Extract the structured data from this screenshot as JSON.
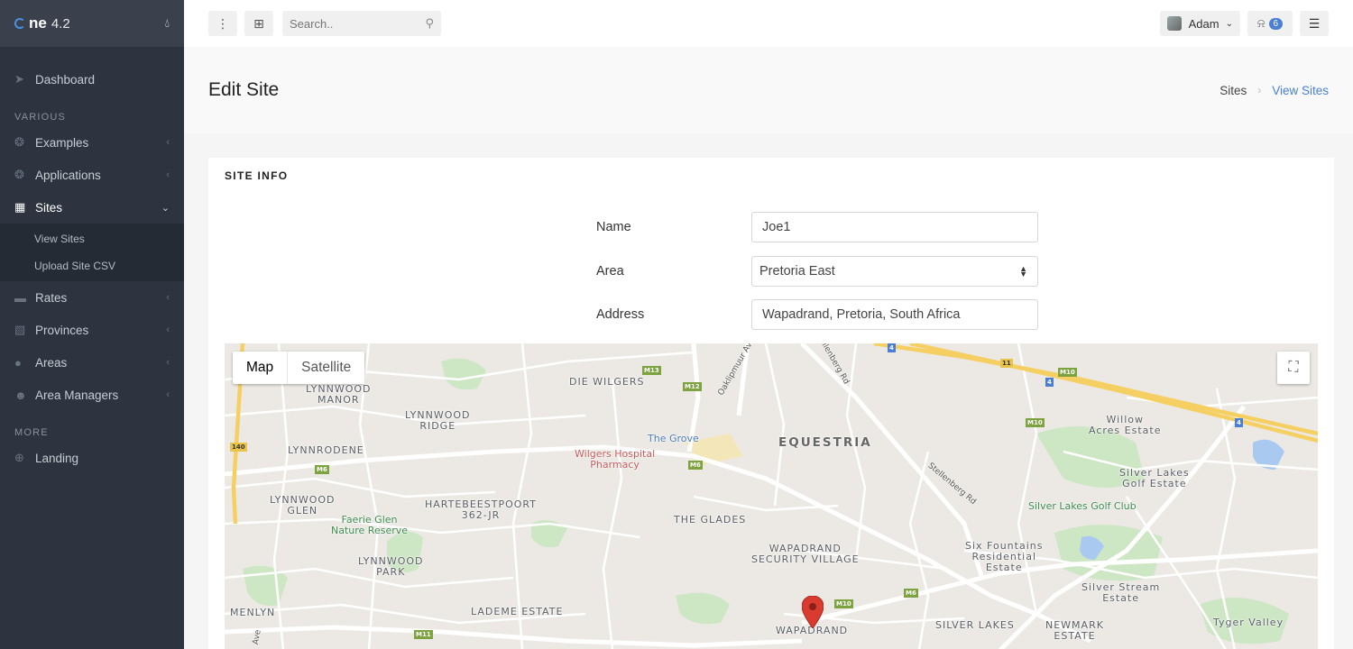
{
  "brand": {
    "logo": "ne",
    "version": "4.2"
  },
  "sidebar": {
    "items": [
      {
        "label": "Dashboard",
        "icon": "paper-plane-icon"
      }
    ],
    "various_heading": "VARIOUS",
    "various": [
      {
        "label": "Examples",
        "icon": "bulb-icon"
      },
      {
        "label": "Applications",
        "icon": "bulb-icon"
      },
      {
        "label": "Sites",
        "icon": "building-icon",
        "active": true
      }
    ],
    "sites_sub": [
      {
        "label": "View Sites"
      },
      {
        "label": "Upload Site CSV"
      }
    ],
    "various2": [
      {
        "label": "Rates",
        "icon": "money-icon"
      },
      {
        "label": "Provinces",
        "icon": "cubes-icon"
      },
      {
        "label": "Areas",
        "icon": "map-marker-icon"
      },
      {
        "label": "Area Managers",
        "icon": "users-icon"
      }
    ],
    "more_heading": "MORE",
    "more": [
      {
        "label": "Landing",
        "icon": "globe-icon"
      }
    ]
  },
  "topbar": {
    "search_placeholder": "Search..",
    "user_name": "Adam",
    "notification_count": "6"
  },
  "header": {
    "title": "Edit Site",
    "breadcrumb": [
      "Sites",
      "View Sites"
    ]
  },
  "block": {
    "title": "SITE INFO",
    "fields": {
      "name_label": "Name",
      "name_value": "Joe1",
      "area_label": "Area",
      "area_value": "Pretoria East",
      "address_label": "Address",
      "address_value": "Wapadrand, Pretoria, South Africa"
    }
  },
  "map": {
    "type_buttons": [
      "Map",
      "Satellite"
    ],
    "labels": {
      "lynnwood_manor": "LYNNWOOD\nMANOR",
      "die_wilgers": "DIE WILGERS",
      "lynnwood_ridge": "LYNNWOOD\nRIDGE",
      "lynnrodene": "LYNNRODENE",
      "equestria": "EQUESTRIA",
      "willow_acres": "Willow\nAcres Estate",
      "the_grove": "The Grove",
      "wilgers_hospital": "Wilgers Hospital\nPharmacy",
      "silver_lakes_golf_estate": "Silver Lakes\nGolf Estate",
      "silver_lakes_golf_club": "Silver Lakes Golf Club",
      "lynnwood_glen": "LYNNWOOD\nGLEN",
      "hartebeestpoort": "HARTEBEESTPOORT\n362-JR",
      "faerie_glen": "Faerie Glen\nNature Reserve",
      "the_glades": "THE GLADES",
      "wapadrand_sv": "WAPADRAND\nSECURITY VILLAGE",
      "six_fountains": "Six Fountains\nResidential\nEstate",
      "lynnwood_park": "LYNNWOOD\nPARK",
      "silver_stream": "Silver Stream\nEstate",
      "menlyn": "MENLYN",
      "lademe": "LADEME ESTATE",
      "wapadrand": "WAPADRAND",
      "silver_lakes": "SILVER LAKES",
      "newmark_estate": "NEWMARK\nESTATE",
      "tyger_valley": "Tyger Valley",
      "oaklipmuur": "Oaklipmuur Ave",
      "stellenberg": "Stellenberg Rd",
      "stellenberg2": "Stellenberg Rd",
      "ave": "Ave"
    },
    "shields": [
      "M13",
      "M12",
      "M6",
      "M6",
      "140",
      "M10",
      "M10",
      "11",
      "4",
      "4",
      "4",
      "M10",
      "M6",
      "M11"
    ]
  }
}
